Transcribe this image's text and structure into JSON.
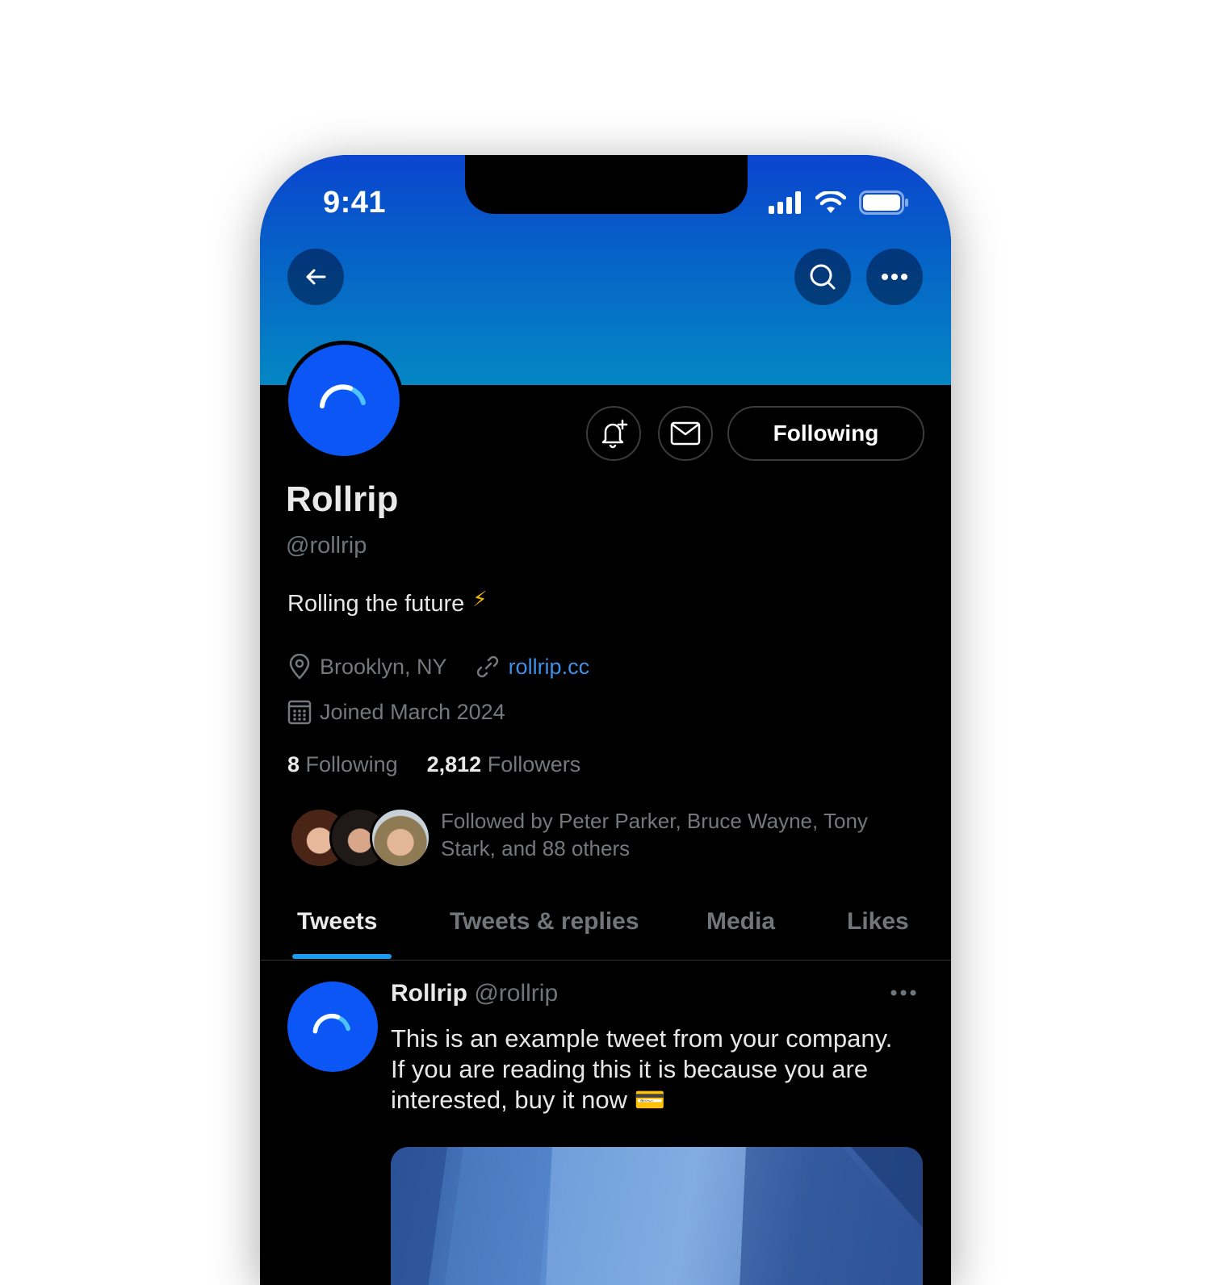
{
  "status_bar": {
    "time": "9:41"
  },
  "header": {
    "back_icon": "arrow-left-icon",
    "search_icon": "search-icon",
    "more_icon": "more-horizontal-icon"
  },
  "profile": {
    "display_name": "Rollrip",
    "handle": "@rollrip",
    "bio": "Rolling the future",
    "bio_emoji": "⚡",
    "location": "Brooklyn, NY",
    "website": "rollrip.cc",
    "joined": "Joined March 2024",
    "following_count": "8",
    "following_label": "Following",
    "followers_count": "2,812",
    "followers_label": "Followers",
    "followed_by": "Followed by Peter Parker, Bruce Wayne, Tony Stark, and 88 others"
  },
  "actions": {
    "notify_icon": "bell-plus-icon",
    "message_icon": "mail-icon",
    "following_button": "Following"
  },
  "tabs": [
    {
      "label": "Tweets",
      "active": true
    },
    {
      "label": "Tweets & replies",
      "active": false
    },
    {
      "label": "Media",
      "active": false
    },
    {
      "label": "Likes",
      "active": false
    }
  ],
  "tweet": {
    "author": "Rollrip",
    "handle": "@rollrip",
    "text": "This is an example tweet from your company. If you are reading this it is because you are interested, buy it now 💳"
  },
  "colors": {
    "banner_top": "#0a45cf",
    "banner_bottom": "#0487c4",
    "avatar_blue": "#0b56f5",
    "link": "#3d8fe8",
    "tab_underline": "#1d9bf0"
  }
}
